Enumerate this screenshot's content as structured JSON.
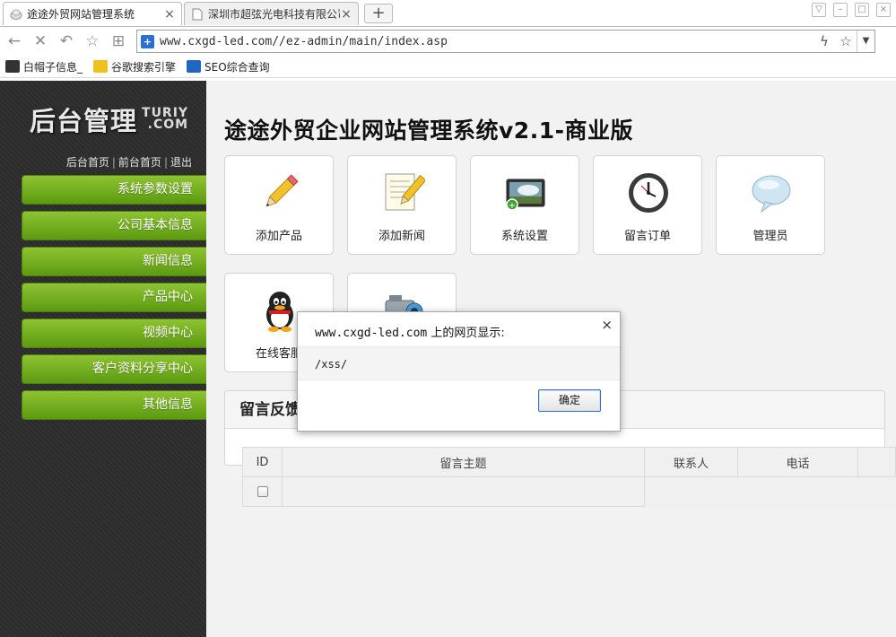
{
  "browser": {
    "tabs": [
      {
        "title": "途途外贸网站管理系统",
        "active": true
      },
      {
        "title": "深圳市超弦光电科技有限公司",
        "active": false
      }
    ],
    "new_tab": "+",
    "url": "www.cxgd-led.com//ez-admin/main/index.asp",
    "bookmarks": [
      {
        "label": "白帽子信息_",
        "icon": "bookmark-icon",
        "color": "#333333"
      },
      {
        "label": "谷歌搜索引擎",
        "icon": "google-icon",
        "color": "#3a7d1e"
      },
      {
        "label": "SEO综合查询",
        "icon": "seo-icon",
        "color": "#1f66c2"
      }
    ]
  },
  "sidebar": {
    "logo_main": "后台管理",
    "logo_sub_top": "TURIY",
    "logo_sub_bottom": ".COM",
    "links": [
      "后台首页",
      "前台首页",
      "退出"
    ],
    "links_sep": "|",
    "menu": [
      "系统参数设置",
      "公司基本信息",
      "新闻信息",
      "产品中心",
      "视频中心",
      "客户资料分享中心",
      "其他信息"
    ],
    "accent_color": "#7ab325"
  },
  "main": {
    "title": "途途外贸企业网站管理系统v2.1-商业版",
    "quick_tiles": [
      {
        "label": "添加产品",
        "icon": "pencil-icon"
      },
      {
        "label": "添加新闻",
        "icon": "document-pencil-icon"
      },
      {
        "label": "系统设置",
        "icon": "screen-settings-icon"
      },
      {
        "label": "留言订单",
        "icon": "clock-icon"
      },
      {
        "label": "管理员",
        "icon": "speech-bubble-icon"
      },
      {
        "label": "在线客服",
        "icon": "qq-penguin-icon"
      },
      {
        "label": "",
        "icon": "video-camera-icon"
      }
    ],
    "message_panel": {
      "title": "留言反馈"
    },
    "table": {
      "headers": [
        "ID",
        "留言主题",
        "联系人",
        "电话"
      ]
    }
  },
  "dialog": {
    "title_host": "www.cxgd-led.com",
    "title_suffix": " 上的网页显示:",
    "message": "/xss/",
    "ok_label": "确定",
    "close": "×"
  }
}
